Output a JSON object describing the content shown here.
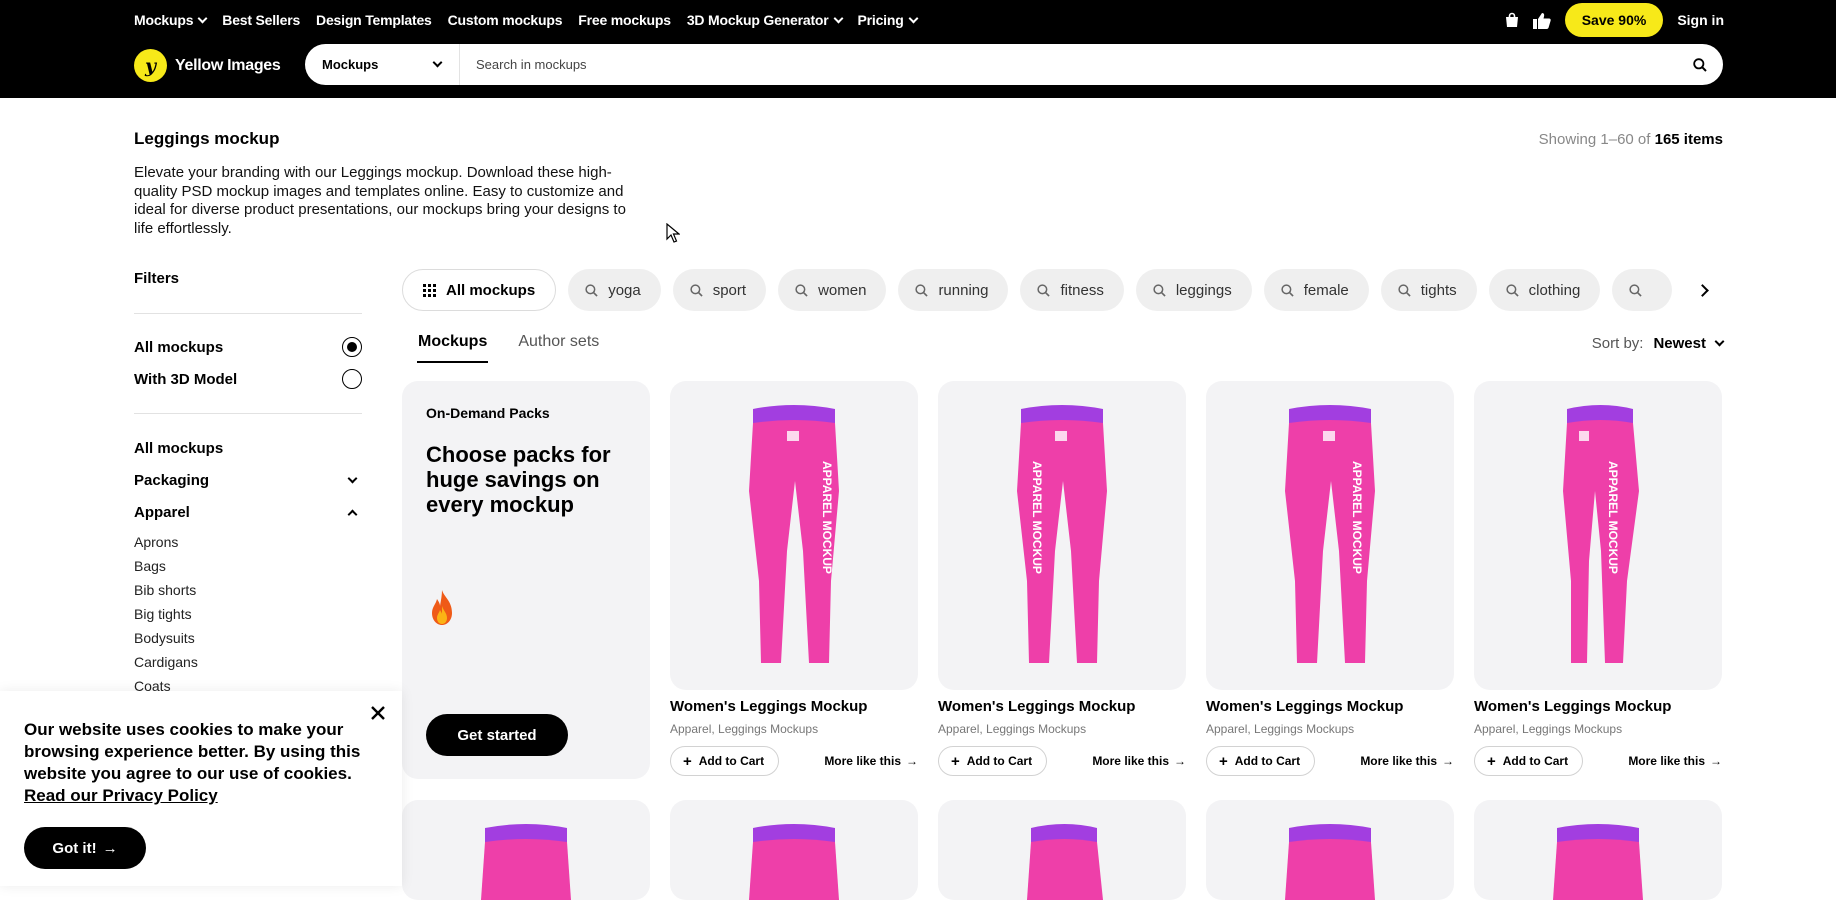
{
  "nav": {
    "items": [
      {
        "label": "Mockups",
        "dropdown": true
      },
      {
        "label": "Best Sellers",
        "dropdown": false
      },
      {
        "label": "Design Templates",
        "dropdown": false
      },
      {
        "label": "Custom mockups",
        "dropdown": false
      },
      {
        "label": "Free mockups",
        "dropdown": false
      },
      {
        "label": "3D Mockup Generator",
        "dropdown": true
      },
      {
        "label": "Pricing",
        "dropdown": true
      }
    ],
    "save_label": "Save 90%",
    "signin_label": "Sign in"
  },
  "brand": {
    "name": "Yellow Images",
    "accent": "#f7e919"
  },
  "search": {
    "category": "Mockups",
    "placeholder": "Search in mockups"
  },
  "page": {
    "title": "Leggings mockup",
    "showing_prefix": "Showing 1–60 of",
    "showing_total": "165 items",
    "description": "Elevate your branding with our Leggings mockup. Download these high-quality PSD mockup images and templates online. Easy to customize and ideal for diverse product presentations, our mockups bring your designs to life effortlessly."
  },
  "filters": {
    "title": "Filters",
    "options": [
      {
        "label": "All mockups",
        "selected": true
      },
      {
        "label": "With 3D Model",
        "selected": false
      }
    ],
    "categories": {
      "all": "All mockups",
      "packaging": "Packaging",
      "apparel": "Apparel",
      "apparel_items": [
        "Aprons",
        "Bags",
        "Bib shorts",
        "Big tights",
        "Bodysuits",
        "Cardigans",
        "Coats"
      ]
    }
  },
  "chips": {
    "all_label": "All mockups",
    "tags": [
      "yoga",
      "sport",
      "women",
      "running",
      "fitness",
      "leggings",
      "female",
      "tights",
      "clothing",
      ""
    ]
  },
  "tabs": [
    {
      "label": "Mockups",
      "active": true
    },
    {
      "label": "Author sets",
      "active": false
    }
  ],
  "sort": {
    "label": "Sort by:",
    "value": "Newest"
  },
  "promo": {
    "label": "On-Demand Packs",
    "title": "Choose packs for huge savings on every mockup",
    "button": "Get started"
  },
  "products": [
    {
      "title": "Women's Leggings Mockup",
      "category": "Apparel, Leggings Mockups",
      "cart_label": "Add to Cart",
      "more_label": "More like this",
      "print": "APPAREL MOCKUP"
    },
    {
      "title": "Women's Leggings Mockup",
      "category": "Apparel, Leggings Mockups",
      "cart_label": "Add to Cart",
      "more_label": "More like this",
      "print": "APPAREL MOCKUP"
    },
    {
      "title": "Women's Leggings Mockup",
      "category": "Apparel, Leggings Mockups",
      "cart_label": "Add to Cart",
      "more_label": "More like this",
      "print": "APPAREL MOCKUP"
    },
    {
      "title": "Women's Leggings Mockup",
      "category": "Apparel, Leggings Mockups",
      "cart_label": "Add to Cart",
      "more_label": "More like this",
      "print": "APPAREL MOCKUP"
    }
  ],
  "product_color": "#ee3fa9",
  "waistband_color": "#a23ee0",
  "cookie": {
    "text": "Our website uses cookies to make your browsing experience better. By using this website you agree to our use of cookies.",
    "link": "Read our Privacy Policy",
    "button": "Got it!"
  }
}
